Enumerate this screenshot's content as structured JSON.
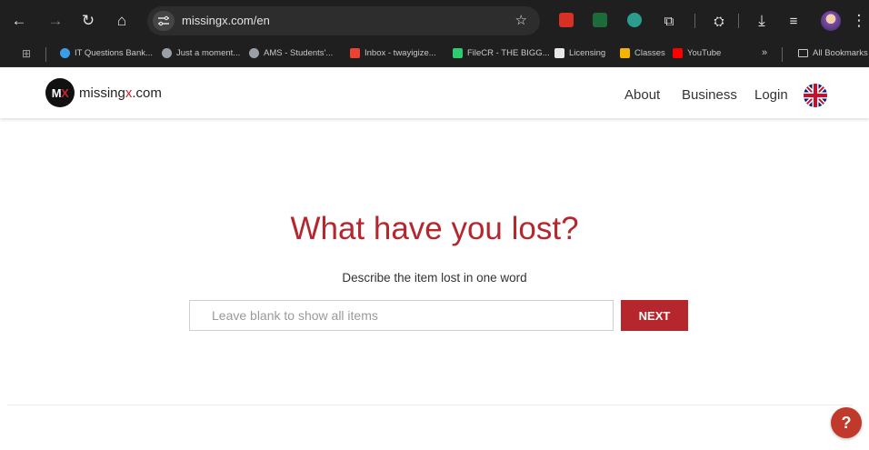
{
  "browser": {
    "url": "missingx.com/en",
    "bookmarks": [
      {
        "label": "IT Questions Bank...",
        "icon": "edge-icon",
        "color": "#3b9de8"
      },
      {
        "label": "Just a moment...",
        "icon": "globe-icon",
        "color": "#9aa0a6"
      },
      {
        "label": "AMS - Students'...",
        "icon": "globe-icon",
        "color": "#9aa0a6"
      },
      {
        "label": "Inbox - twayigize...",
        "icon": "gmail-icon",
        "color": "#ea4335"
      },
      {
        "label": "FileCR - THE BIGG...",
        "icon": "filecr-icon",
        "color": "#2ecc71"
      },
      {
        "label": "Licensing",
        "icon": "licensing-icon",
        "color": "#e8e8e8"
      },
      {
        "label": "Classes",
        "icon": "classroom-icon",
        "color": "#f4b400"
      },
      {
        "label": "YouTube",
        "icon": "youtube-icon",
        "color": "#ff0000"
      }
    ],
    "more": "»",
    "all_bookmarks": "All Bookmarks"
  },
  "header": {
    "logo_mark_m": "M",
    "logo_mark_x": "X",
    "logo_text_pre": "missing",
    "logo_text_x": "x",
    "logo_text_post": ".com",
    "nav": [
      "About",
      "Business",
      "Login"
    ],
    "language_icon": "uk-flag-icon"
  },
  "hero": {
    "title": "What have you lost?",
    "subtitle": "Describe the item lost in one word",
    "input_placeholder": "Leave blank to show all items",
    "input_value": "",
    "button_label": "NEXT"
  },
  "help": {
    "label": "?"
  },
  "colors": {
    "accent": "#b5262d",
    "chrome_bg": "#1f1f1f",
    "omnibox_bg": "#2d2d2d"
  }
}
